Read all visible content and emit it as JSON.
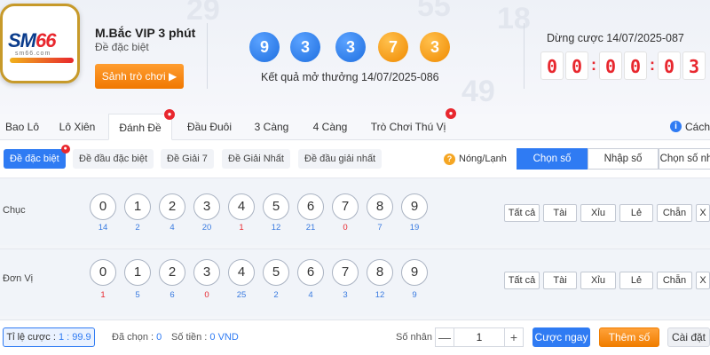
{
  "header": {
    "logo_text_a": "SM",
    "logo_text_b": "66",
    "logo_sub": "sm66.com",
    "game_title": "M.Bắc VIP 3 phút",
    "game_subtitle": "Đề đặc biệt",
    "lobby_button": "Sảnh trò chơi ▶",
    "result_balls": [
      {
        "value": "9",
        "color": "#1f6fe0"
      },
      {
        "value": "3",
        "color": "#1f6fe0"
      },
      {
        "value": "3",
        "color": "#1f6fe0"
      },
      {
        "value": "7",
        "color": "#f08a00"
      },
      {
        "value": "3",
        "color": "#f08a00"
      }
    ],
    "result_label": "Kết quả mở thưởng 14/07/2025-086",
    "stop_label": "Dừng cược 14/07/2025-087",
    "countdown": [
      "0",
      "0",
      "0",
      "0",
      "0",
      "3"
    ],
    "countdown_sep": ":"
  },
  "tabs": {
    "items": [
      {
        "label": "Bao Lô",
        "active": false,
        "hot": false
      },
      {
        "label": "Lô Xiên",
        "active": false,
        "hot": false
      },
      {
        "label": "Đánh Đề",
        "active": true,
        "hot": true
      },
      {
        "label": "Đầu Đuôi",
        "active": false,
        "hot": false
      },
      {
        "label": "3 Càng",
        "active": false,
        "hot": false
      },
      {
        "label": "4 Càng",
        "active": false,
        "hot": false
      },
      {
        "label": "Trò Chơi Thú Vị",
        "active": false,
        "hot": true
      }
    ],
    "info_icon": "i",
    "info_label": "Cách"
  },
  "subtabs": {
    "items": [
      {
        "label": "Đề đặc biệt",
        "active": true
      },
      {
        "label": "Đề đầu đặc biệt",
        "active": false
      },
      {
        "label": "Đề Giải 7",
        "active": false
      },
      {
        "label": "Đề Giải Nhất",
        "active": false
      },
      {
        "label": "Đề đầu giải nhất",
        "active": false
      }
    ],
    "hot_cold_icon": "?",
    "hot_cold_label": "Nóng/Lạnh",
    "modes": [
      {
        "label": "Chọn số",
        "active": true
      },
      {
        "label": "Nhập số",
        "active": false
      },
      {
        "label": "Chọn số nh",
        "active": false
      }
    ]
  },
  "rows": [
    {
      "label": "Chục",
      "numbers": [
        "0",
        "1",
        "2",
        "3",
        "4",
        "5",
        "6",
        "7",
        "8",
        "9"
      ],
      "counts": [
        "14",
        "2",
        "4",
        "20",
        "1",
        "12",
        "21",
        "0",
        "7",
        "19"
      ],
      "count_colors": [
        "#3a7be0",
        "#3a7be0",
        "#3a7be0",
        "#3a7be0",
        "#e8272e",
        "#3a7be0",
        "#3a7be0",
        "#e8272e",
        "#3a7be0",
        "#3a7be0"
      ],
      "quick": [
        "Tất cả",
        "Tài",
        "Xỉu",
        "Lẻ",
        "Chẵn",
        "X"
      ]
    },
    {
      "label": "Đơn Vị",
      "numbers": [
        "0",
        "1",
        "2",
        "3",
        "4",
        "5",
        "6",
        "7",
        "8",
        "9"
      ],
      "counts": [
        "1",
        "5",
        "6",
        "0",
        "25",
        "2",
        "4",
        "3",
        "12",
        "9"
      ],
      "count_colors": [
        "#e8272e",
        "#3a7be0",
        "#3a7be0",
        "#e8272e",
        "#3a7be0",
        "#3a7be0",
        "#3a7be0",
        "#3a7be0",
        "#3a7be0",
        "#3a7be0"
      ],
      "quick": [
        "Tất cả",
        "Tài",
        "Xỉu",
        "Lẻ",
        "Chẵn",
        "X"
      ]
    }
  ],
  "footer": {
    "ratio_label": "Tỉ lệ cược :",
    "ratio_value": "1 : 99.9",
    "selected_label": "Đã chọn :",
    "selected_value": "0",
    "amount_label": "Số tiền :",
    "amount_value": "0 VND",
    "multiplier_label": "Số nhân :",
    "multiplier_minus": "—",
    "multiplier_value": "1",
    "multiplier_plus": "+",
    "bet_now": "Cược ngay",
    "add_number": "Thêm số",
    "settings": "Cài đặt"
  },
  "colors": {
    "accent_blue": "#2f7bf3",
    "accent_orange": "#f08a00",
    "countdown_red": "#e8272e"
  }
}
